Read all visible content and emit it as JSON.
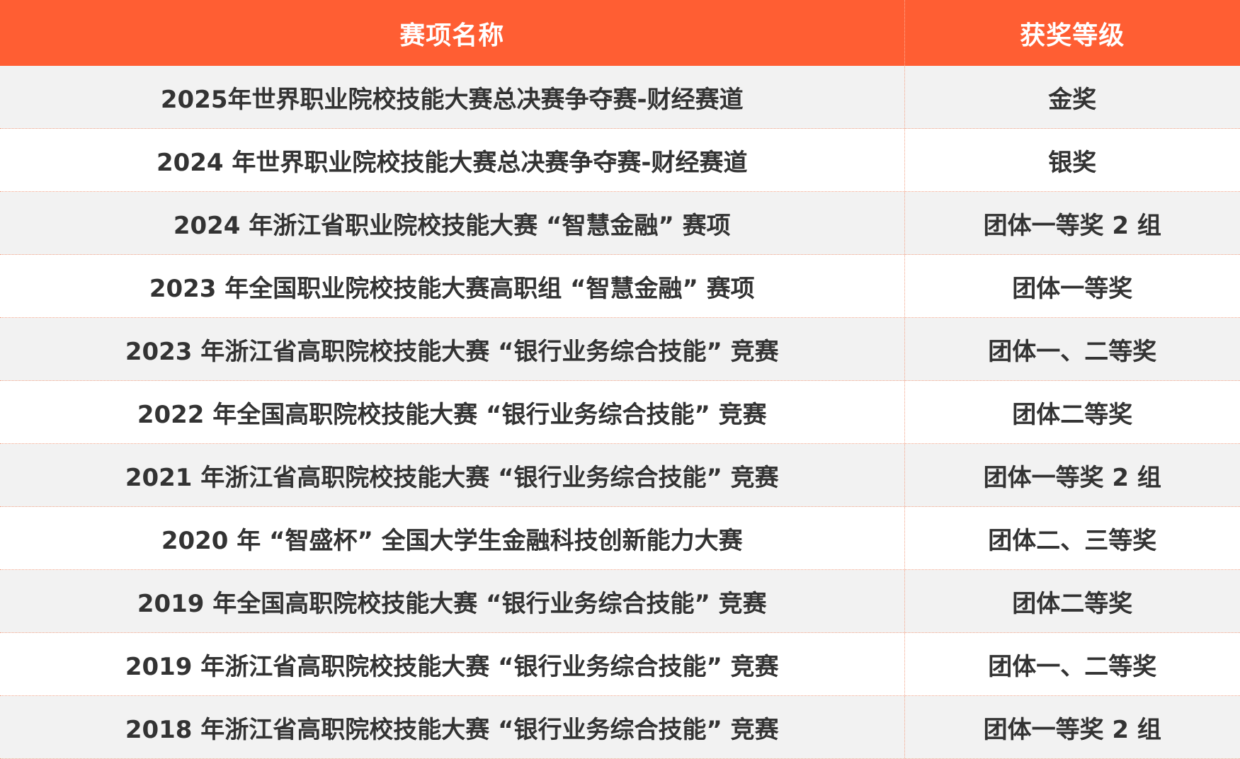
{
  "headers": {
    "name": "赛项名称",
    "level": "获奖等级"
  },
  "rows": [
    {
      "name": "2025年世界职业院校技能大赛总决赛争夺赛-财经赛道",
      "level": "金奖"
    },
    {
      "name": "2024 年世界职业院校技能大赛总决赛争夺赛-财经赛道",
      "level": "银奖"
    },
    {
      "name": "2024 年浙江省职业院校技能大赛 “智慧金融” 赛项",
      "level": "团体一等奖 2 组"
    },
    {
      "name": "2023 年全国职业院校技能大赛高职组 “智慧金融” 赛项",
      "level": "团体一等奖"
    },
    {
      "name": "2023 年浙江省高职院校技能大赛 “银行业务综合技能” 竞赛",
      "level": "团体一、二等奖"
    },
    {
      "name": "2022 年全国高职院校技能大赛 “银行业务综合技能” 竞赛",
      "level": "团体二等奖"
    },
    {
      "name": "2021 年浙江省高职院校技能大赛 “银行业务综合技能” 竞赛",
      "level": "团体一等奖 2 组"
    },
    {
      "name": "2020 年 “智盛杯” 全国大学生金融科技创新能力大赛",
      "level": "团体二、三等奖"
    },
    {
      "name": "2019 年全国高职院校技能大赛 “银行业务综合技能” 竞赛",
      "level": "团体二等奖"
    },
    {
      "name": "2019 年浙江省高职院校技能大赛 “银行业务综合技能” 竞赛",
      "level": "团体一、二等奖"
    },
    {
      "name": "2018 年浙江省高职院校技能大赛 “银行业务综合技能” 竞赛",
      "level": "团体一等奖 2 组"
    }
  ],
  "colors": {
    "header_bg": "#ff5e33",
    "header_text": "#ffffff",
    "row_alt_bg": "#f2f2f2",
    "row_bg": "#ffffff",
    "divider": "#f3a58a",
    "body_text": "#333333"
  }
}
